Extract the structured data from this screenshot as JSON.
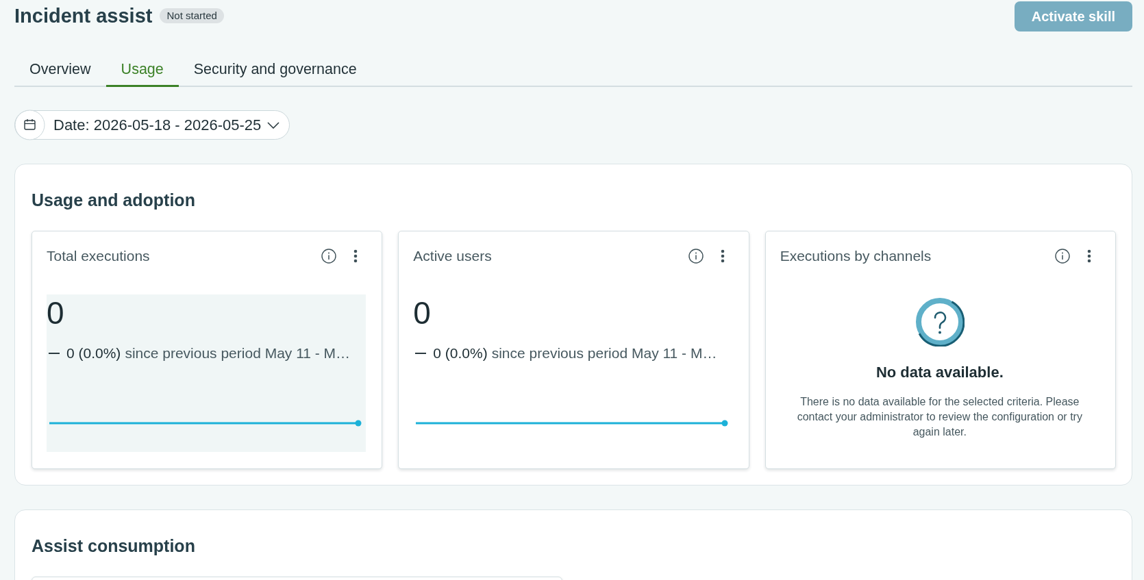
{
  "header": {
    "title": "Incident assist",
    "status_badge": "Not started",
    "primary_button": {
      "label": "Activate skill",
      "disabled": true
    }
  },
  "tabs": [
    {
      "label": "Overview",
      "selected": false
    },
    {
      "label": "Usage",
      "selected": true
    },
    {
      "label": "Security and governance",
      "selected": false
    }
  ],
  "date_filter": {
    "label": "Date: 2026-05-18 - 2026-05-25"
  },
  "sections": [
    {
      "title": "Usage and adoption",
      "cards": [
        {
          "kind": "metric",
          "title": "Total executions",
          "value": "0",
          "change": "0 (0.0%)",
          "comparison": "since previous period May 11 - M…",
          "highlighted": true
        },
        {
          "kind": "metric",
          "title": "Active users",
          "value": "0",
          "change": "0 (0.0%)",
          "comparison": "since previous period May 11 - M…",
          "highlighted": false
        },
        {
          "kind": "empty",
          "title": "Executions by channels",
          "message": "No data available.",
          "description": "There is no data available for the selected criteria. Please contact your administrator to review the configuration or try again later."
        }
      ]
    },
    {
      "title": "Assist consumption",
      "cards": [
        {
          "kind": "cut_off"
        }
      ]
    }
  ]
}
